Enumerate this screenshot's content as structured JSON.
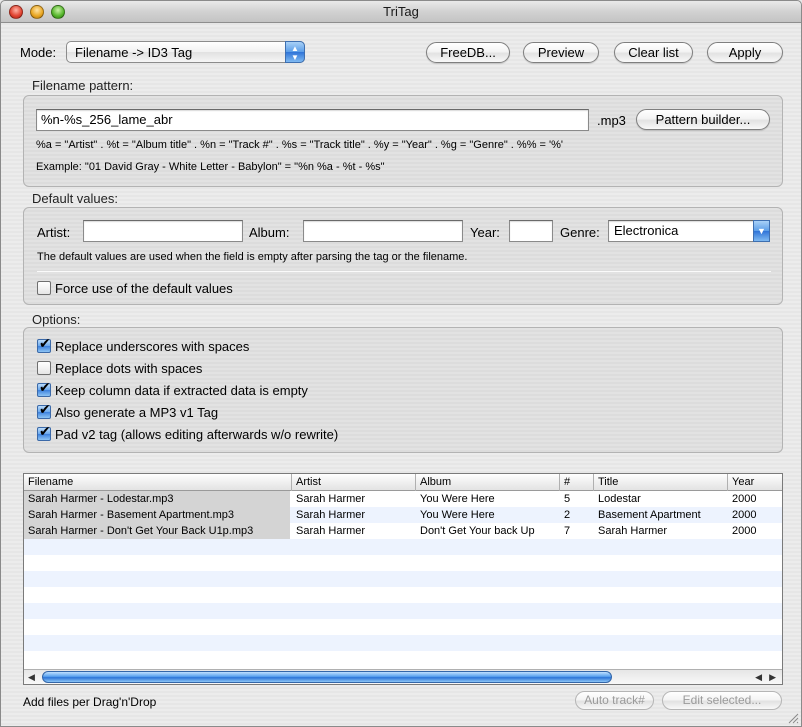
{
  "window": {
    "title": "TriTag"
  },
  "toolbar": {
    "mode_label": "Mode:",
    "mode_value": "Filename -> ID3 Tag",
    "freedb": "FreeDB...",
    "preview": "Preview",
    "clear_list": "Clear list",
    "apply": "Apply"
  },
  "pattern": {
    "group_label": "Filename pattern:",
    "value": "%n-%s_256_lame_abr",
    "ext": ".mp3",
    "builder_button": "Pattern builder...",
    "legend": "%a = \"Artist\" . %t = \"Album title\" . %n = \"Track #\" . %s = \"Track title\" . %y = \"Year\"  . %g = \"Genre\" . %% = '%'",
    "example": "Example: \"01 David Gray - White Letter - Babylon\" = \"%n %a - %t - %s\""
  },
  "defaults": {
    "group_label": "Default values:",
    "artist_label": "Artist:",
    "artist_value": "",
    "album_label": "Album:",
    "album_value": "",
    "year_label": "Year:",
    "year_value": "",
    "genre_label": "Genre:",
    "genre_value": "Electronica",
    "hint": "The default values are used when the field is empty after parsing the tag or the filename.",
    "force_label": "Force use of the default values",
    "force_checked": false
  },
  "options": {
    "group_label": "Options:",
    "items": [
      {
        "label": "Replace underscores with spaces",
        "checked": true
      },
      {
        "label": "Replace dots with spaces",
        "checked": false
      },
      {
        "label": "Keep column data if extracted data is empty",
        "checked": true
      },
      {
        "label": "Also generate a MP3 v1 Tag",
        "checked": true
      },
      {
        "label": "Pad v2 tag (allows editing afterwards w/o rewrite)",
        "checked": true
      }
    ]
  },
  "table": {
    "columns": [
      "Filename",
      "Artist",
      "Album",
      "#",
      "Title",
      "Year"
    ],
    "rows": [
      [
        "Sarah Harmer -  Lodestar.mp3",
        "Sarah Harmer",
        "You Were Here",
        "5",
        "Lodestar",
        "2000"
      ],
      [
        "Sarah Harmer - Basement Apartment.mp3",
        "Sarah Harmer",
        "You Were Here",
        "2",
        "Basement Apartment",
        "2000"
      ],
      [
        "Sarah Harmer - Don't Get Your Back U1p.mp3",
        "Sarah Harmer",
        "Don't Get Your back Up",
        "7",
        " Sarah Harmer",
        "2000"
      ]
    ]
  },
  "footer": {
    "status": "Add files per Drag'n'Drop",
    "auto_track": "Auto track#",
    "edit_selected": "Edit selected..."
  }
}
